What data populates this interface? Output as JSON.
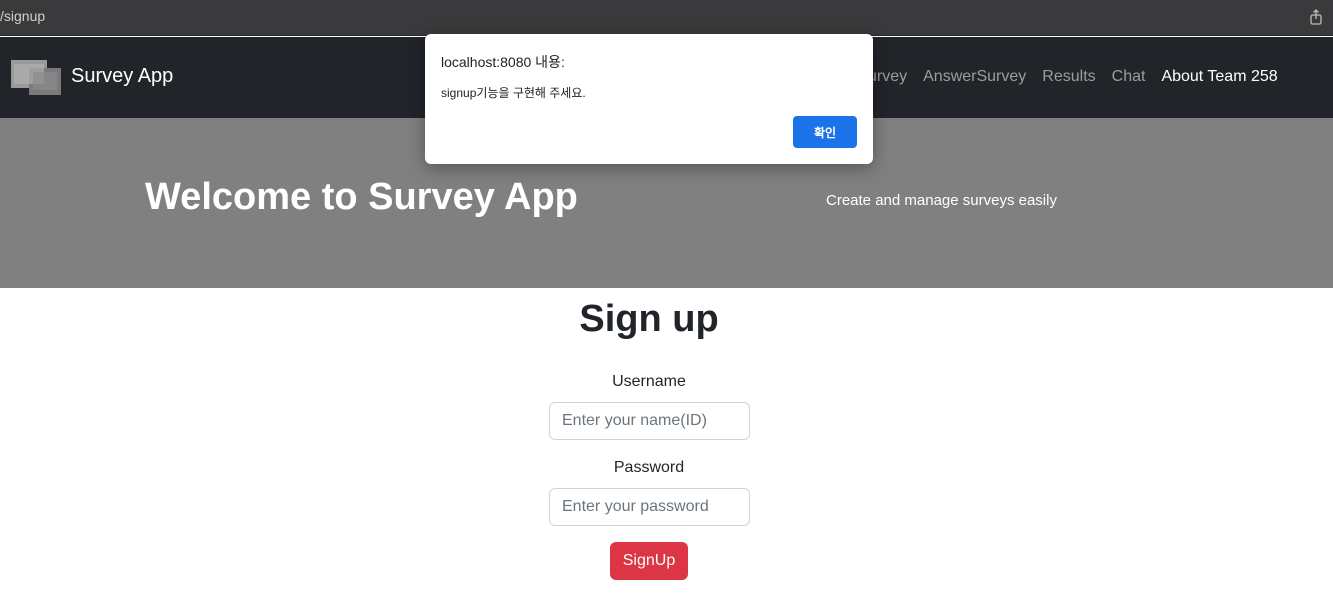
{
  "browser": {
    "url": "/signup"
  },
  "navbar": {
    "brand": "Survey App",
    "links": [
      "urvey",
      "AnswerSurvey",
      "Results",
      "Chat",
      "About Team 258"
    ]
  },
  "hero": {
    "title": "Welcome to Survey App",
    "subtitle": "Create and manage surveys easily"
  },
  "form": {
    "title": "Sign up",
    "username_label": "Username",
    "username_placeholder": "Enter your name(ID)",
    "password_label": "Password",
    "password_placeholder": "Enter your password",
    "submit_label": "SignUp"
  },
  "dialog": {
    "title": "localhost:8080 내용:",
    "message": "signup기능을 구현해 주세요.",
    "ok_label": "확인"
  },
  "colors": {
    "navbar_bg": "#212529",
    "hero_bg": "#808080",
    "signup_button": "#dc3545",
    "dialog_button": "#1a73e8"
  },
  "icons": {
    "share": "share-icon",
    "logo": "team-logo-image"
  }
}
